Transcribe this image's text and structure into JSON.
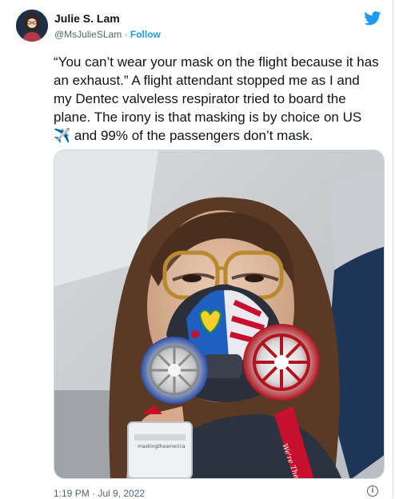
{
  "author": {
    "name": "Julie S. Lam",
    "handle": "@MsJulieSLam",
    "separator": " · ",
    "follow_label": "Follow"
  },
  "tweet": {
    "text": "“You can’t wear your mask on the flight because it has an exhaust.” A flight attendant stopped me as I and my Dentec valveless respirator tried to board the plane. The irony is that masking is by choice on US ✈️ and 99% of the passengers don’t mask.",
    "timestamp": "1:19 PM · Jul 9, 2022",
    "media_alt": "Selfie of a woman with glasses wearing a hand-painted half-face respirator on a plane"
  },
  "badge_text": {
    "lanyard": "We're There.",
    "card": "maskingtheamerica"
  },
  "icons": {
    "brand": "twitter-bird-icon",
    "info": "info-icon"
  },
  "colors": {
    "accent": "#1d9bf0",
    "muted": "#536471",
    "text": "#0f1419"
  }
}
